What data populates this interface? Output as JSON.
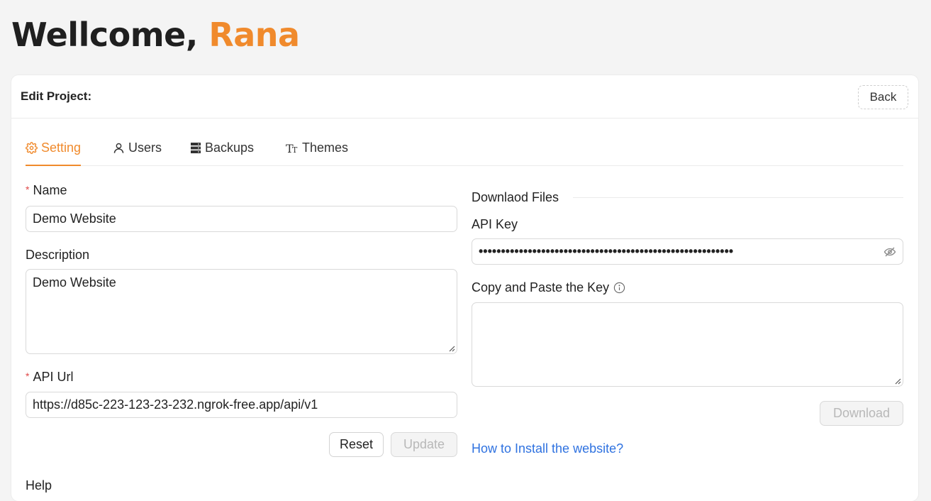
{
  "greeting": {
    "prefix": "Wellcome, ",
    "name": "Rana"
  },
  "card": {
    "title": "Edit Project:",
    "back_label": "Back"
  },
  "tabs": [
    {
      "label": "Setting",
      "icon": "gear-icon",
      "active": true
    },
    {
      "label": "Users",
      "icon": "user-icon",
      "active": false
    },
    {
      "label": "Backups",
      "icon": "database-icon",
      "active": false
    },
    {
      "label": "Themes",
      "icon": "font-size-icon",
      "active": false
    }
  ],
  "form": {
    "name_label": "Name",
    "name_value": "Demo Website",
    "description_label": "Description",
    "description_value": "Demo Website",
    "api_url_label": "API Url",
    "api_url_value": "https://d85c-223-123-23-232.ngrok-free.app/api/v1",
    "reset_label": "Reset",
    "update_label": "Update",
    "next_label": "Help"
  },
  "download": {
    "section_title": "Downlaod Files",
    "api_key_label": "API Key",
    "api_key_masked": "•••••••••••••••••••••••••••••••••••••••••••••••••••••••••",
    "paste_label": "Copy and Paste the Key",
    "paste_value": "",
    "download_label": "Download",
    "install_link": "How to Install the website?"
  },
  "colors": {
    "accent": "#f08a2c",
    "link": "#2f72e0",
    "required": "#e04848"
  }
}
